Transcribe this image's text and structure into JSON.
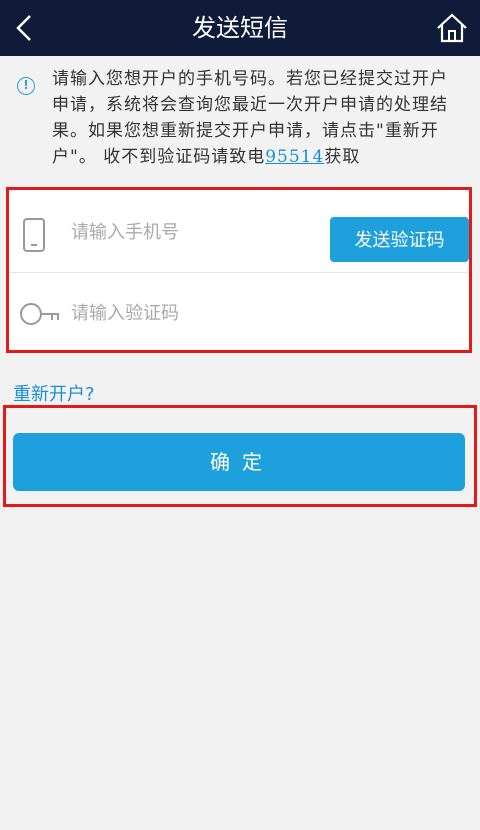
{
  "header": {
    "title": "发送短信"
  },
  "notice": {
    "text_before_link": "请输入您想开户的手机号码。若您已经提交过开户申请，系统将会查询您最近一次开户申请的处理结果。如果您想重新提交开户申请，请点击\"重新开户\"。 收不到验证码请致电",
    "phone": "95514",
    "text_after_link": "获取"
  },
  "form": {
    "phone_placeholder": "请输入手机号",
    "code_placeholder": "请输入验证码",
    "send_code_label": "发送验证码"
  },
  "reopen_link": "重新开户?",
  "confirm_label": "确定",
  "colors": {
    "header_bg": "#101b3a",
    "accent": "#1ea0dc",
    "highlight": "#e31a1a"
  }
}
